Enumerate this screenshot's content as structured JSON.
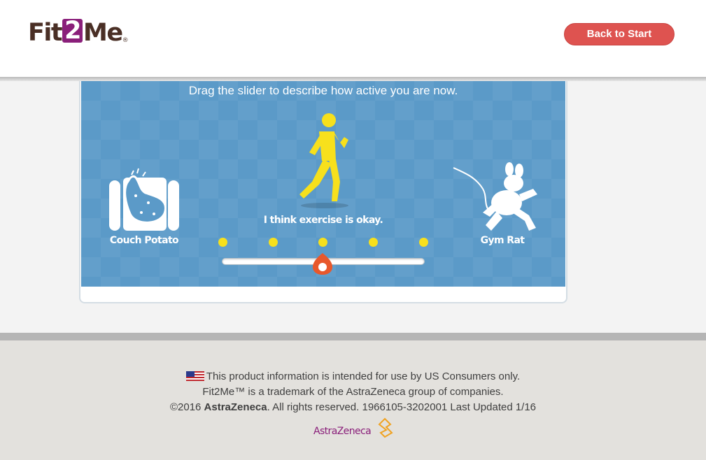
{
  "header": {
    "logo_pre": "Fit",
    "logo_two": "2",
    "logo_post": "Me",
    "logo_tm": "®",
    "back_button": "Back to Start"
  },
  "activity": {
    "instruction": "Drag the slider to describe how active you are now.",
    "left_label": "Couch Potato",
    "right_label": "Gym Rat",
    "current_label": "I think exercise is okay.",
    "slider": {
      "steps": 5,
      "selected_step": 3
    },
    "icons": {
      "left": "couch-potato-icon",
      "center": "walking-person-icon",
      "right": "gym-rat-icon"
    },
    "colors": {
      "panel": "#5b9ac8",
      "accent": "#f7e01c",
      "handle": "#e8582c"
    }
  },
  "footer": {
    "line1": "This product information is intended for use by US Consumers only.",
    "line2": "Fit2Me™ is a trademark of the AstraZeneca group of companies.",
    "line3_prefix": "©2016 ",
    "line3_brand": "AstraZeneca",
    "line3_suffix": ". All rights reserved. 1966105-3202001 Last Updated 1/16",
    "company_logo": "AstraZeneca"
  }
}
